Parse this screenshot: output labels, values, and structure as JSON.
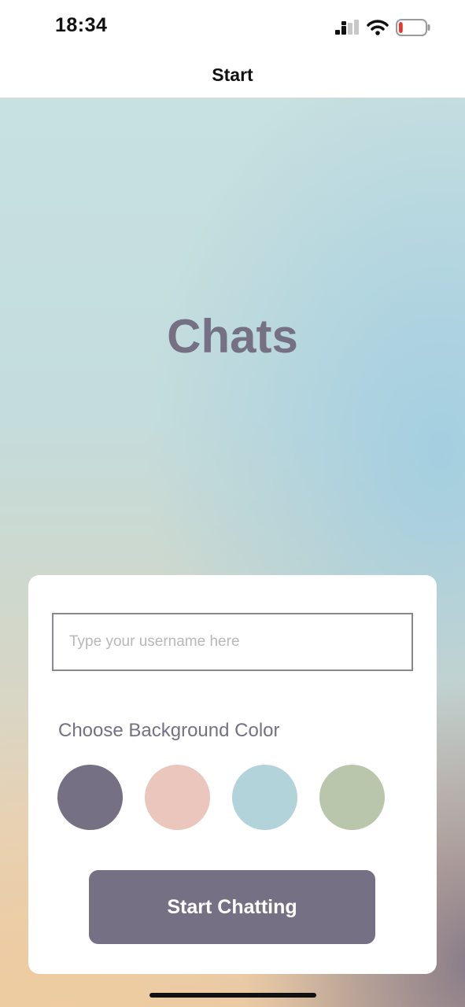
{
  "status_bar": {
    "time": "18:34",
    "icons": [
      "cellular-signal-icon",
      "wifi-icon",
      "battery-icon"
    ],
    "battery_level": 0.15,
    "battery_color": "#e8382d"
  },
  "nav": {
    "title": "Start"
  },
  "app_title": "Chats",
  "form": {
    "username_placeholder": "Type your username here",
    "username_value": "",
    "color_label": "Choose Background Color",
    "colors": [
      "#757083",
      "#ebc6bc",
      "#b3d3da",
      "#b9c6ab"
    ],
    "start_button_label": "Start Chatting"
  },
  "theme": {
    "accent": "#757083",
    "card_background": "#ffffff"
  }
}
